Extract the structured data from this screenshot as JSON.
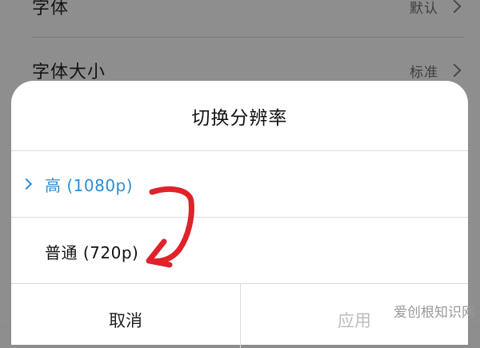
{
  "settings": {
    "rows": [
      {
        "label": "字体",
        "value": "默认"
      },
      {
        "label": "字体大小",
        "value": "标准"
      }
    ]
  },
  "dialog": {
    "title": "切换分辨率",
    "options": [
      {
        "label": "高 (1080p)",
        "selected": true
      },
      {
        "label": "普通 (720p)",
        "selected": false
      }
    ],
    "buttons": {
      "cancel": "取消",
      "apply": "应用"
    }
  },
  "colors": {
    "accent": "#2a8ed6",
    "annotation": "#e0222b",
    "overlay": "#8e8e8e"
  },
  "watermark": "爱创根知识网"
}
